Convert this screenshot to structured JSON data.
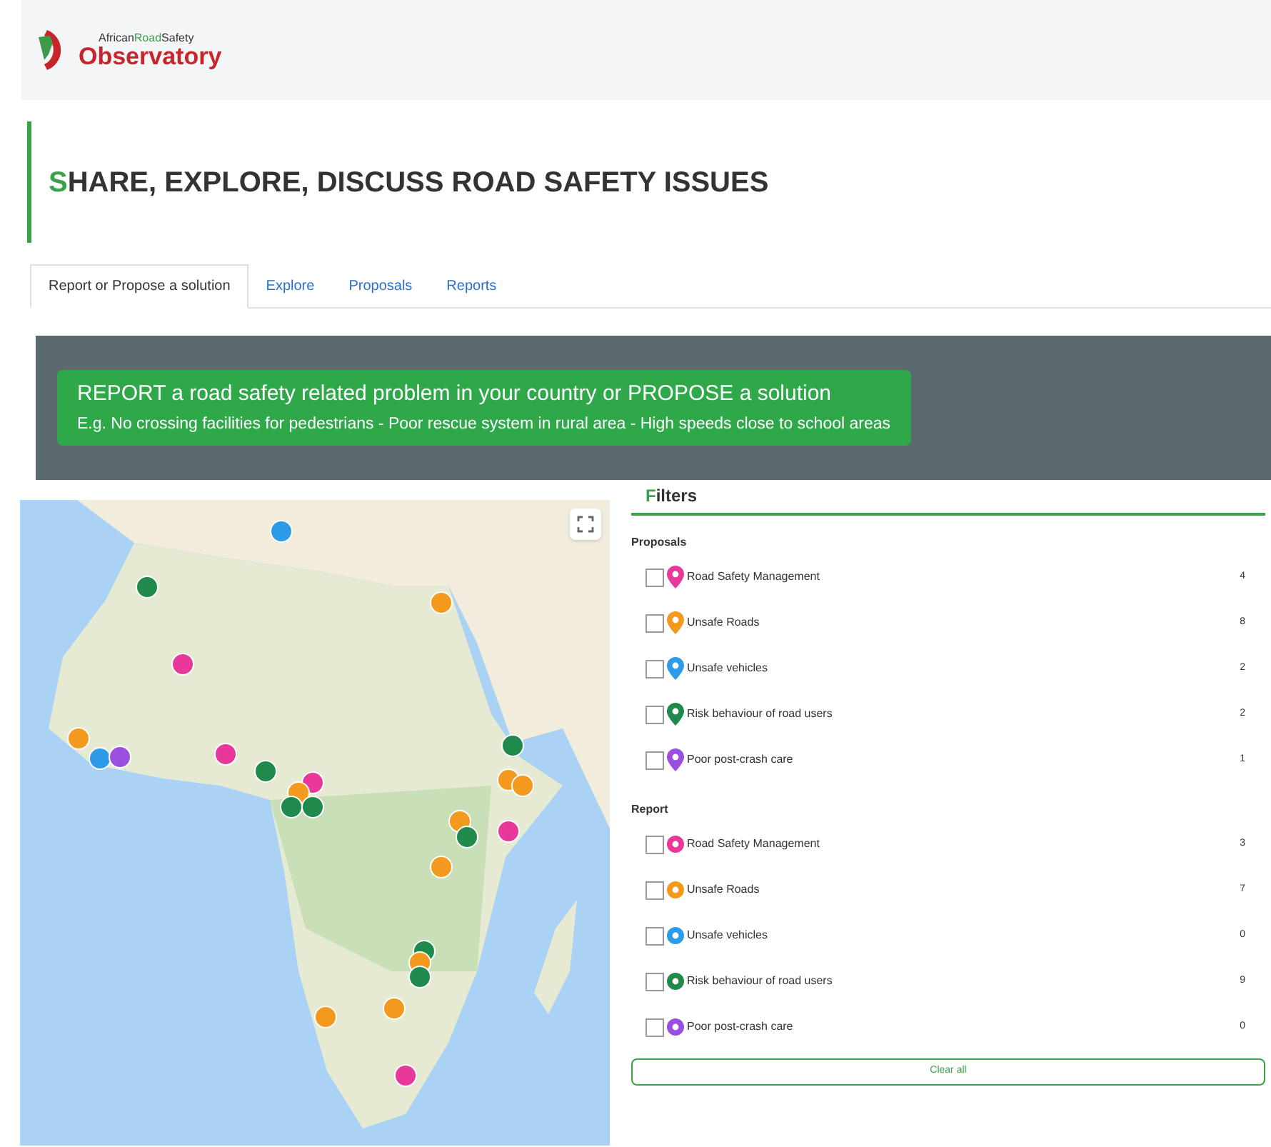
{
  "logo": {
    "line1": [
      "African",
      "Road",
      "Safety"
    ],
    "line2": "Observatory"
  },
  "page_title": "SHARE, EXPLORE, DISCUSS ROAD SAFETY ISSUES",
  "tabs": [
    {
      "label": "Report or Propose a solution",
      "selected": true
    },
    {
      "label": "Explore",
      "selected": false
    },
    {
      "label": "Proposals",
      "selected": false
    },
    {
      "label": "Reports",
      "selected": false
    }
  ],
  "banner": {
    "title": "REPORT a road safety related problem in your country or PROPOSE a solution",
    "subtitle": "E.g. No crossing facilities for pedestrians - Poor rescue system in rural area - High speeds close to school areas"
  },
  "filters": {
    "title": "Filters",
    "groups": [
      {
        "title": "Proposals",
        "kind": "pin",
        "items": [
          {
            "label": "Road Safety Management",
            "count": "4",
            "checked": false,
            "color": "#e8399a"
          },
          {
            "label": "Unsafe Roads",
            "count": "8",
            "checked": false,
            "color": "#f39a1e"
          },
          {
            "label": "Unsafe vehicles",
            "count": "2",
            "checked": false,
            "color": "#2d9be8"
          },
          {
            "label": "Risk behaviour of road users",
            "count": "2",
            "checked": false,
            "color": "#1f8a4c"
          },
          {
            "label": "Poor post-crash care",
            "count": "1",
            "checked": false,
            "color": "#9b4fe0"
          }
        ]
      },
      {
        "title": "Report",
        "kind": "circle",
        "items": [
          {
            "label": "Road Safety Management",
            "count": "3",
            "checked": false,
            "color": "#e8399a"
          },
          {
            "label": "Unsafe Roads",
            "count": "7",
            "checked": false,
            "color": "#f39a1e"
          },
          {
            "label": "Unsafe vehicles",
            "count": "0",
            "checked": false,
            "color": "#2d9be8"
          },
          {
            "label": "Risk behaviour of road users",
            "count": "9",
            "checked": false,
            "color": "#1f8a4c"
          },
          {
            "label": "Poor post-crash care",
            "count": "0",
            "checked": false,
            "color": "#9b4fe0"
          }
        ]
      }
    ],
    "clear_button": "Clear all"
  }
}
